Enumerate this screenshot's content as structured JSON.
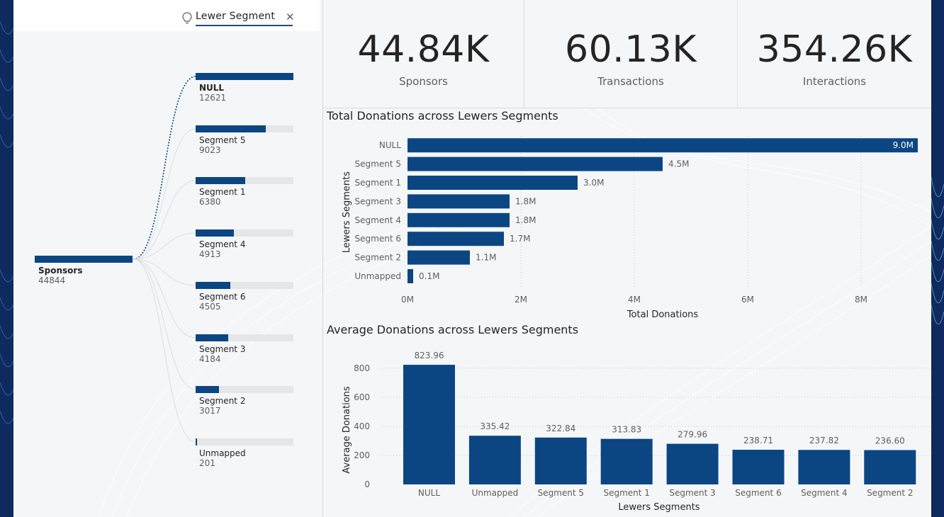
{
  "tree": {
    "level_title": "Lewer Segment",
    "root": {
      "name": "Sponsors",
      "value": "44844"
    },
    "nodes": [
      {
        "name": "NULL",
        "value": "12621",
        "share": 1.0
      },
      {
        "name": "Segment 5",
        "value": "9023",
        "share": 0.715
      },
      {
        "name": "Segment 1",
        "value": "6380",
        "share": 0.505
      },
      {
        "name": "Segment 4",
        "value": "4913",
        "share": 0.389
      },
      {
        "name": "Segment 6",
        "value": "4505",
        "share": 0.357
      },
      {
        "name": "Segment 3",
        "value": "4184",
        "share": 0.332
      },
      {
        "name": "Segment 2",
        "value": "3017",
        "share": 0.239
      },
      {
        "name": "Unmapped",
        "value": "201",
        "share": 0.016
      }
    ]
  },
  "kpis": [
    {
      "value": "44.84K",
      "label": "Sponsors"
    },
    {
      "value": "60.13K",
      "label": "Transactions"
    },
    {
      "value": "354.26K",
      "label": "Interactions"
    }
  ],
  "colors": {
    "bar": "#0b4683",
    "accent_dark": "#0e2a5e",
    "gridline": "#c8c8c8"
  },
  "chart_data": [
    {
      "type": "bar",
      "orientation": "horizontal",
      "title": "Total Donations across Lewers Segments",
      "xlabel": "Total Donations",
      "ylabel": "Lewers Segments",
      "categories": [
        "NULL",
        "Segment 5",
        "Segment 1",
        "Segment 3",
        "Segment 4",
        "Segment 6",
        "Segment 2",
        "Unmapped"
      ],
      "values": [
        9.0,
        4.5,
        3.0,
        1.8,
        1.8,
        1.7,
        1.1,
        0.1
      ],
      "data_labels": [
        "9.0M",
        "4.5M",
        "3.0M",
        "1.8M",
        "1.8M",
        "1.7M",
        "1.1M",
        "0.1M"
      ],
      "xlim": [
        0,
        9
      ],
      "xticks": [
        "0M",
        "2M",
        "4M",
        "6M",
        "8M"
      ],
      "grid": true
    },
    {
      "type": "bar",
      "orientation": "vertical",
      "title": "Average Donations across Lewers Segments",
      "xlabel": "Lewers Segments",
      "ylabel": "Average Donations",
      "categories": [
        "NULL",
        "Unmapped",
        "Segment 5",
        "Segment 1",
        "Segment 3",
        "Segment 6",
        "Segment 4",
        "Segment 2"
      ],
      "values": [
        823.96,
        335.42,
        322.84,
        313.83,
        279.96,
        238.71,
        237.82,
        236.6
      ],
      "data_labels": [
        "823.96",
        "335.42",
        "322.84",
        "313.83",
        "279.96",
        "238.71",
        "237.82",
        "236.60"
      ],
      "ylim": [
        0,
        800
      ],
      "yticks": [
        "0",
        "200",
        "400",
        "600",
        "800"
      ],
      "grid": true
    }
  ]
}
